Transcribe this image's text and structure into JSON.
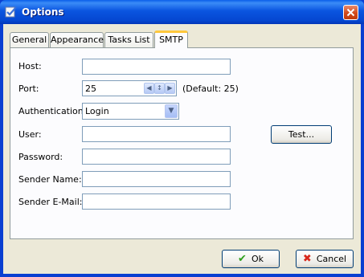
{
  "window": {
    "title": "Options",
    "accent": "#0a55e0"
  },
  "tabs": [
    {
      "label": "General"
    },
    {
      "label": "Appearance"
    },
    {
      "label": "Tasks List"
    },
    {
      "label": "SMTP",
      "active": true
    }
  ],
  "form": {
    "host_label": "Host:",
    "host_value": "",
    "port_label": "Port:",
    "port_value": "25",
    "port_default": "(Default: 25)",
    "auth_label": "Authentication:",
    "auth_value": "Login",
    "user_label": "User:",
    "user_value": "",
    "password_label": "Password:",
    "password_value": "",
    "sender_name_label": "Sender Name:",
    "sender_name_value": "",
    "sender_email_label": "Sender E-Mail:",
    "sender_email_value": "",
    "test_label": "Test..."
  },
  "footer": {
    "ok_label": "Ok",
    "cancel_label": "Cancel"
  }
}
